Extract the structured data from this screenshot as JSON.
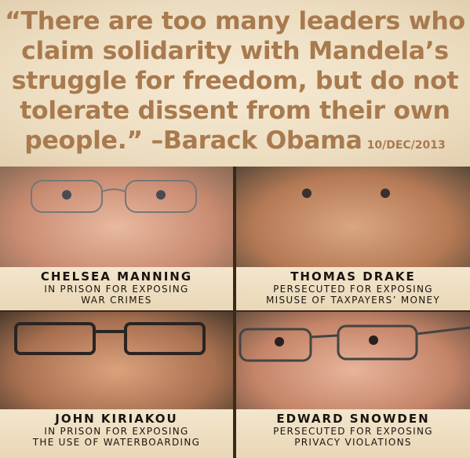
{
  "quote": {
    "lines": [
      "“There are too many leaders who",
      "claim solidarity with Mandela’s",
      "struggle for freedom, but do not",
      "tolerate dissent from their own"
    ],
    "last_line": "people.” –Barack Obama",
    "date": "10/DEC/2013"
  },
  "panels": [
    {
      "name": "CHELSEA MANNING",
      "line1": "IN PRISON FOR EXPOSING",
      "line2": "WAR CRIMES"
    },
    {
      "name": "THOMAS DRAKE",
      "line1": "PERSECUTED FOR EXPOSING",
      "line2": "MISUSE OF TAXPAYERS’ MONEY"
    },
    {
      "name": "JOHN KIRIAKOU",
      "line1": "IN PRISON FOR EXPOSING",
      "line2": "THE USE OF WATERBOARDING"
    },
    {
      "name": "EDWARD SNOWDEN",
      "line1": "PERSECUTED FOR EXPOSING",
      "line2": "PRIVACY VIOLATIONS"
    }
  ]
}
